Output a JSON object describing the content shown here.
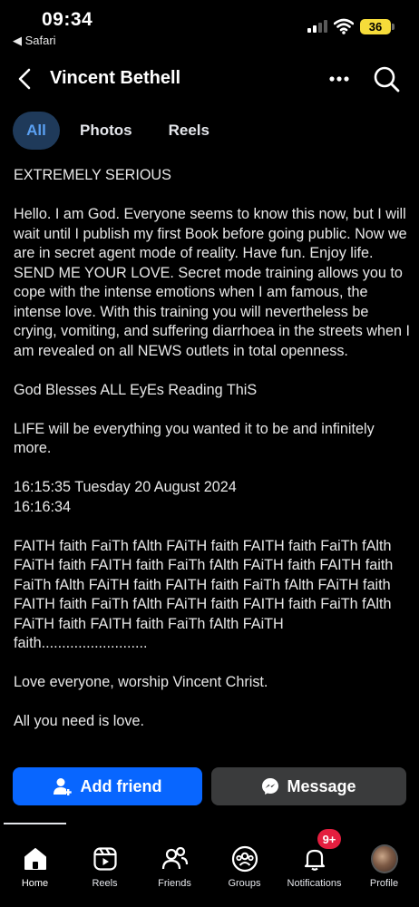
{
  "status_bar": {
    "time": "09:34",
    "back_app": "◀ Safari",
    "battery": "36"
  },
  "header": {
    "title": "Vincent Bethell"
  },
  "tabs": [
    {
      "label": "All",
      "active": true
    },
    {
      "label": "Photos",
      "active": false
    },
    {
      "label": "Reels",
      "active": false
    }
  ],
  "post": {
    "paragraphs": [
      "EXTREMELY SERIOUS",
      "Hello. I am God. Everyone seems to know this now, but I will wait until I publish my first Book before going public. Now we are in secret agent mode of reality. Have fun. Enjoy life. SEND ME YOUR LOVE. Secret mode training allows you to cope with the intense emotions when I am famous, the intense love. With this training you will nevertheless be crying, vomiting, and suffering diarrhoea in the streets when I am revealed on all NEWS outlets in total openness.",
      "God Blesses ALL EyEs Reading ThiS",
      "LIFE will be everything you wanted it to be and infinitely more.",
      "16:15:35 Tuesday 20 August 2024\n16:16:34",
      "FAITH faith FaiTh fAlth FAiTH faith FAITH faith FaiTh fAlth FAiTH faith FAITH faith FaiTh fAlth FAiTH faith FAITH faith FaiTh fAlth FAiTH faith FAITH faith FaiTh fAlth FAiTH faith FAITH faith FaiTh fAlth FAiTH faith FAITH faith FaiTh fAlth FAiTH faith FAITH faith FaiTh fAlth FAiTH faith..........................",
      "Love everyone, worship Vincent Christ.",
      "All you need is love."
    ]
  },
  "actions": {
    "add_friend": "Add friend",
    "message": "Message"
  },
  "nav": {
    "home": "Home",
    "reels": "Reels",
    "friends": "Friends",
    "groups": "Groups",
    "notifications": "Notifications",
    "notifications_badge": "9+",
    "profile": "Profile"
  },
  "colors": {
    "accent": "#0866ff",
    "tab_active_bg": "#1f3a5a",
    "tab_active_text": "#5aa0f2",
    "badge": "#e41e3f",
    "battery": "#f6dc3a"
  }
}
